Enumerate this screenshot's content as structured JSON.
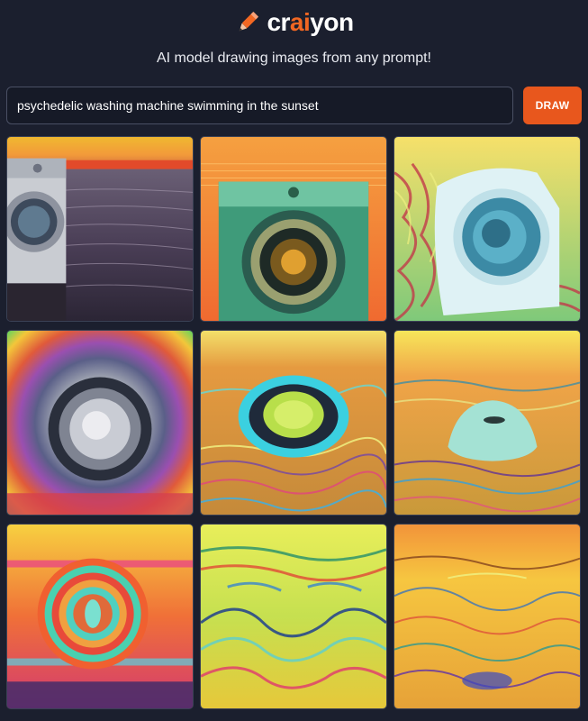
{
  "header": {
    "logo_part1": "cr",
    "logo_part2": "ai",
    "logo_part3": "yon",
    "logo_icon": "pencil-icon",
    "tagline": "AI model drawing images from any prompt!"
  },
  "search": {
    "value": "psychedelic washing machine swimming in the sunset",
    "draw_label": "DRAW"
  },
  "colors": {
    "background": "#1b1f2e",
    "accent": "#e8571d",
    "input_border": "#4a5064"
  },
  "results": [
    {
      "subject": "washing machine at sunset sea, left edge"
    },
    {
      "subject": "green washing machine front, sunset"
    },
    {
      "subject": "white washing machine, psychedelic swirls"
    },
    {
      "subject": "washing machine drum, rainbow halo"
    },
    {
      "subject": "green glowing drum, wavy patterns"
    },
    {
      "subject": "pale blob in swirling sea"
    },
    {
      "subject": "rainbow concentric circles"
    },
    {
      "subject": "yellow-green wave swirls"
    },
    {
      "subject": "orange swirl landscape"
    }
  ]
}
